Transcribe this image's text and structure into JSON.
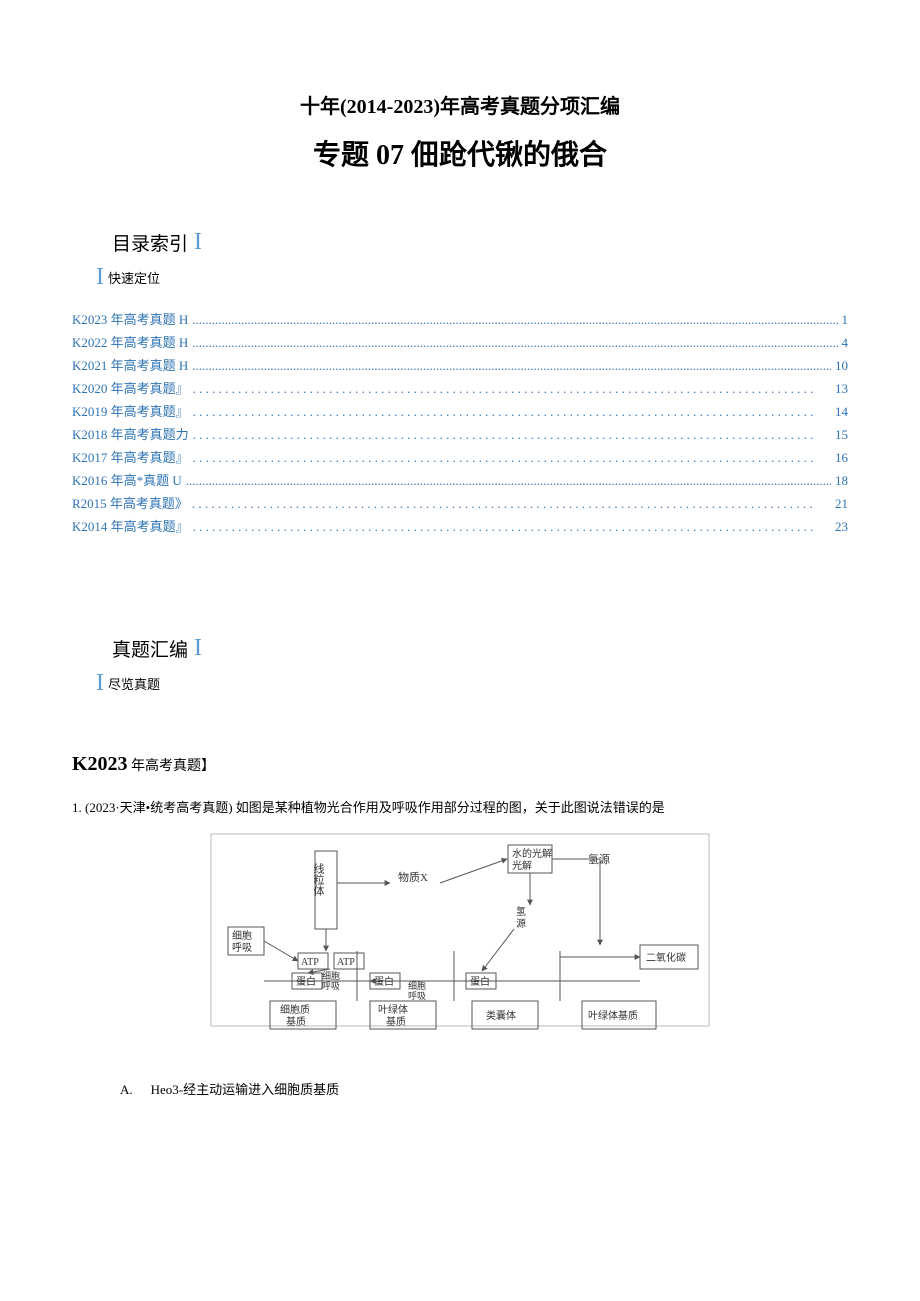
{
  "title_line1": "十年(2014-2023)年高考真题分项汇编",
  "title_line2": "专题 07 佃跄代锹的俄合",
  "section_index": {
    "label": "目录索引",
    "i": "I",
    "sub_i": "I",
    "sub_label": "快速定位"
  },
  "toc": [
    {
      "label": "K2023 年高考真题 H",
      "page": "1",
      "style": "fine"
    },
    {
      "label": "K2022 年高考真题 H",
      "page": "4",
      "style": "fine"
    },
    {
      "label": "K2021 年高考真题 H",
      "page": "10",
      "style": "fine"
    },
    {
      "label": "K2020 年高考真题』",
      "page": "13",
      "style": "coarse"
    },
    {
      "label": "K2019 年高考真题』",
      "page": "14",
      "style": "coarse"
    },
    {
      "label": "K2018 年高考真题力",
      "page": "15",
      "style": "coarse"
    },
    {
      "label": "K2017 年高考真题』",
      "page": "16",
      "style": "coarse"
    },
    {
      "label": "K2016 年高*真题 U",
      "page": "18",
      "style": "fine"
    },
    {
      "label": "R2015 年高考真题》",
      "page": "21",
      "style": "coarse"
    },
    {
      "label": "K2014 年高考真题』",
      "page": "23",
      "style": "coarse"
    }
  ],
  "section_compile": {
    "label": "真题汇编",
    "i": "I",
    "sub_i": "I",
    "sub_label": "尽览真题"
  },
  "year_heading": {
    "prefix": "K2023",
    "suffix": " 年高考真题】"
  },
  "question1": {
    "text": "1. (2023·天津•统考高考真题) 如图是某种植物光合作用及呼吸作用部分过程的图，关于此图说法错误的是",
    "diagram": {
      "boxes": {
        "mito": "线粒体",
        "cell_resp_left": "细胞呼吸",
        "atp_l": "ATP",
        "atp_r": "ATP",
        "protein1": "蛋白",
        "protein2": "蛋白",
        "protein3": "蛋白",
        "cell_resp_mid1": "细胞呼吸",
        "cell_resp_mid2": "细胞呼吸",
        "wuzhi_x": "物质X",
        "water_split": "水的光解",
        "h_source_top": "氢源",
        "h_source_mid": "氢源",
        "co2": "二氧化碳",
        "bottom1": "细胞质基质",
        "bottom2": "叶绿体基质",
        "bottom3": "类囊体",
        "bottom4": "叶绿体基质"
      }
    },
    "option_a_letter": "A.",
    "option_a_text": "Heo3-经主动运输进入细胞质基质"
  }
}
